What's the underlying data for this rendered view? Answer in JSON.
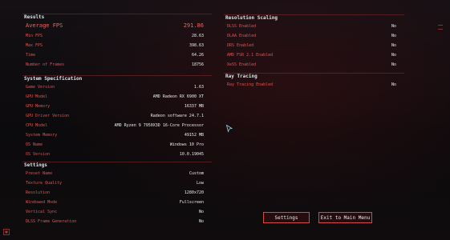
{
  "results": {
    "title": "Results",
    "rows": [
      {
        "label": "Average FPS",
        "value": "291.86",
        "big": true
      },
      {
        "label": "Min FPS",
        "value": "28.63"
      },
      {
        "label": "Max FPS",
        "value": "398.63"
      },
      {
        "label": "Time",
        "value": "64.26"
      },
      {
        "label": "Number of Frames",
        "value": "18756"
      }
    ]
  },
  "system_spec": {
    "title": "System Specification",
    "rows": [
      {
        "label": "Game Version",
        "value": "1.63"
      },
      {
        "label": "GPU Model",
        "value": "AMD Radeon RX 6900 XT"
      },
      {
        "label": "GPU Memory",
        "value": "16337 MB"
      },
      {
        "label": "GPU Driver Version",
        "value": "Radeon software 24.7.1"
      },
      {
        "label": "CPU Model",
        "value": "AMD Ryzen 9 7950X3D 16-Core Processor"
      },
      {
        "label": "System Memory",
        "value": "49152 MB"
      },
      {
        "label": "OS Name",
        "value": "Windows 10 Pro"
      },
      {
        "label": "OS Version",
        "value": "10.0.19045"
      }
    ]
  },
  "settings": {
    "title": "Settings",
    "rows": [
      {
        "label": "Preset Name",
        "value": "Custom"
      },
      {
        "label": "Texture Quality",
        "value": "Low"
      },
      {
        "label": "Resolution",
        "value": "1280x720"
      },
      {
        "label": "Windowed Mode",
        "value": "Fullscreen"
      },
      {
        "label": "Vertical Sync",
        "value": "No"
      },
      {
        "label": "DLSS Frame Generation",
        "value": "No"
      }
    ]
  },
  "resolution_scaling": {
    "title": "Resolution Scaling",
    "rows": [
      {
        "label": "DLSS Enabled",
        "value": "No"
      },
      {
        "label": "DLAA Enabled",
        "value": "No"
      },
      {
        "label": "DRS Enabled",
        "value": "No"
      },
      {
        "label": "AMD FSR 2.1 Enabled",
        "value": "No"
      },
      {
        "label": "XeSS Enabled",
        "value": "No"
      }
    ]
  },
  "ray_tracing": {
    "title": "Ray Tracing",
    "rows": [
      {
        "label": "Ray Tracing Enabled",
        "value": "No"
      }
    ]
  },
  "buttons": {
    "settings_label": "Settings",
    "exit_label": "Exit to Main Menu"
  },
  "colors": {
    "accent_red": "#e0534f",
    "value_white": "#e9edee",
    "button_text": "#dff4f6"
  }
}
